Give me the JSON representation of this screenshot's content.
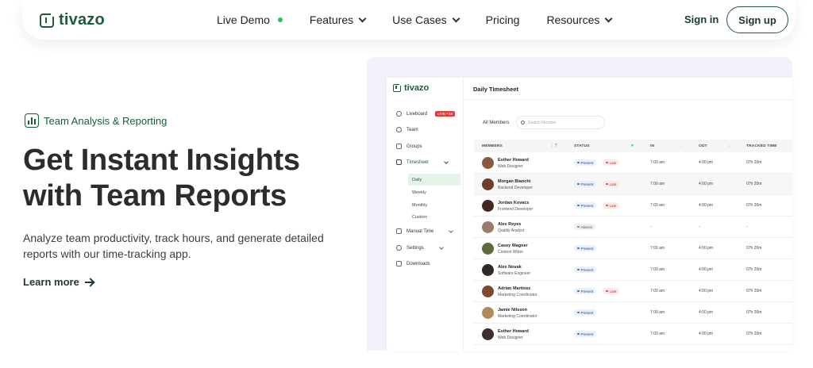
{
  "nav": {
    "logo": "tivazo",
    "links": [
      {
        "label": "Live Demo",
        "has_dot": true
      },
      {
        "label": "Features",
        "dropdown": true
      },
      {
        "label": "Use Cases",
        "dropdown": true
      },
      {
        "label": "Pricing",
        "dropdown": false
      },
      {
        "label": "Resources",
        "dropdown": true
      }
    ],
    "signin": "Sign in",
    "signup": "Sign up"
  },
  "hero": {
    "badge": "Team Analysis & Reporting",
    "title": "Get Instant Insights with Team Reports",
    "subtitle": "Analyze team productivity, track hours, and generate detailed reports with our time-tracking app.",
    "cta": "Learn more"
  },
  "app": {
    "logo": "tivazo",
    "page_title": "Daily Timesheet",
    "sidebar": {
      "liveboard": "Liveboard",
      "live_badge": "LIVE • 50",
      "team": "Team",
      "groups": "Groups",
      "timesheet": "Timesheet",
      "sub": [
        "Daily",
        "Weekly",
        "Monthly",
        "Custom"
      ],
      "manual_time": "Manual Time",
      "settings": "Settings",
      "downloads": "Downloads"
    },
    "filter_label": "All Members",
    "search_placeholder": "Search Member",
    "columns": {
      "members": "MEMBERS",
      "status": "STATUS",
      "in": "IN",
      "out": "OUT",
      "tracked": "TRACKED TIME"
    },
    "rows": [
      {
        "name": "Esther Howard",
        "role": "Web Designer",
        "status": "Present",
        "late": "Late",
        "in": "7:00 am",
        "out": "4:00 pm",
        "tracked": "07h 20m",
        "avatar": "#8a5a3c"
      },
      {
        "name": "Morgan Bianchi",
        "role": "Backend Developer",
        "status": "Present",
        "late": "Late",
        "in": "7:00 am",
        "out": "4:00 pm",
        "tracked": "07h 20m",
        "avatar": "#6b3f2a"
      },
      {
        "name": "Jordan Kovacs",
        "role": "Frontend Developer",
        "status": "Present",
        "late": "Late",
        "in": "7:00 am",
        "out": "4:00 pm",
        "tracked": "07h 20m",
        "avatar": "#3e2a22"
      },
      {
        "name": "Alex Reyes",
        "role": "Quality Analyst",
        "status": "Absent",
        "late": "",
        "in": "-",
        "out": "-",
        "tracked": "-",
        "avatar": "#9a7b6a"
      },
      {
        "name": "Casey Wagner",
        "role": "Content Writer",
        "status": "Present",
        "late": "",
        "in": "7:00 am",
        "out": "4:00 pm",
        "tracked": "07h 20m",
        "avatar": "#5a6b3c"
      },
      {
        "name": "Alex Novak",
        "role": "Software Engineer",
        "status": "Present",
        "late": "",
        "in": "7:00 am",
        "out": "4:00 pm",
        "tracked": "07h 20m",
        "avatar": "#2f2a28"
      },
      {
        "name": "Adrian Martinez",
        "role": "Marketing Coordinator",
        "status": "Present",
        "late": "Late",
        "in": "7:00 am",
        "out": "4:00 pm",
        "tracked": "07h 20m",
        "avatar": "#7a4a34"
      },
      {
        "name": "Jamie Nilsson",
        "role": "Marketing Coordinator",
        "status": "Present",
        "late": "",
        "in": "7:00 am",
        "out": "4:00 pm",
        "tracked": "07h 20m",
        "avatar": "#b08a5a"
      },
      {
        "name": "Esther Howard",
        "role": "Web Designer",
        "status": "Present",
        "late": "",
        "in": "7:00 am",
        "out": "4:00 pm",
        "tracked": "07h 20m",
        "avatar": "#3b2f2a"
      }
    ]
  }
}
